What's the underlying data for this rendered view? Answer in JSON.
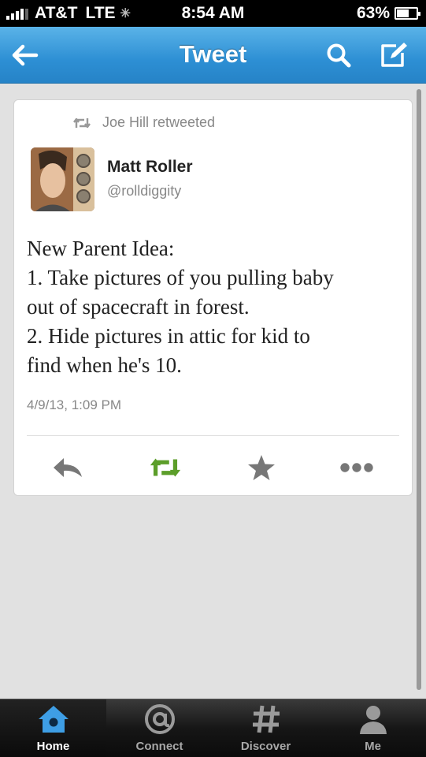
{
  "status_bar": {
    "carrier": "AT&T",
    "network": "LTE",
    "time": "8:54 AM",
    "battery": "63%",
    "battery_level": 0.63
  },
  "nav": {
    "title": "Tweet",
    "icons": [
      "back-arrow-icon",
      "search-icon",
      "compose-icon"
    ]
  },
  "tweet": {
    "retweeted_by": "Joe Hill retweeted",
    "author_name": "Matt Roller",
    "author_handle": "@rolldiggity",
    "text_lines": [
      "New Parent Idea:",
      "1. Take pictures of you pulling baby",
      "out of spacecraft in forest.",
      "2. Hide pictures in attic for kid to",
      "find when he's 10."
    ],
    "date": "4/9/13, 1:09 PM",
    "actions": [
      "reply-icon",
      "retweet-icon",
      "favorite-star-icon",
      "more-dots-icon"
    ],
    "colors": {
      "retweet_active": "#5c9e2a",
      "action_gray": "#7a7a7a"
    }
  },
  "tab_bar": {
    "tabs": [
      {
        "label": "Home",
        "icon": "home-icon",
        "active": true
      },
      {
        "label": "Connect",
        "icon": "at-sign-icon",
        "active": false
      },
      {
        "label": "Discover",
        "icon": "hash-icon",
        "active": false
      },
      {
        "label": "Me",
        "icon": "person-icon",
        "active": false
      }
    ]
  },
  "colors": {
    "nav_blue": "#2d8fd4",
    "tab_active_blue": "#3e9ee5"
  }
}
